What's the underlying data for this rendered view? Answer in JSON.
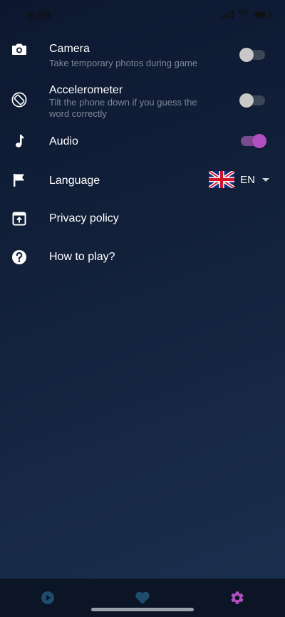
{
  "status_bar": {
    "time": "8:36"
  },
  "settings": {
    "camera": {
      "title": "Camera",
      "subtitle": "Take temporary photos during game",
      "enabled": false
    },
    "accelerometer": {
      "title": "Accelerometer",
      "subtitle": "Tilt the phone down if you guess the word correctly",
      "enabled": false
    },
    "audio": {
      "title": "Audio",
      "enabled": true
    },
    "language": {
      "title": "Language",
      "selected": "EN",
      "flag": "uk-flag-icon"
    },
    "privacy": {
      "title": "Privacy policy"
    },
    "howto": {
      "title": "How to play?"
    }
  },
  "tabbar": {
    "tabs": [
      {
        "icon": "play-icon",
        "active": false
      },
      {
        "icon": "heart-icon",
        "active": false
      },
      {
        "icon": "gear-icon",
        "active": true
      }
    ]
  },
  "colors": {
    "accent": "#b24fc0",
    "tab_inactive": "#1f4b6e",
    "background": "#12203a"
  }
}
